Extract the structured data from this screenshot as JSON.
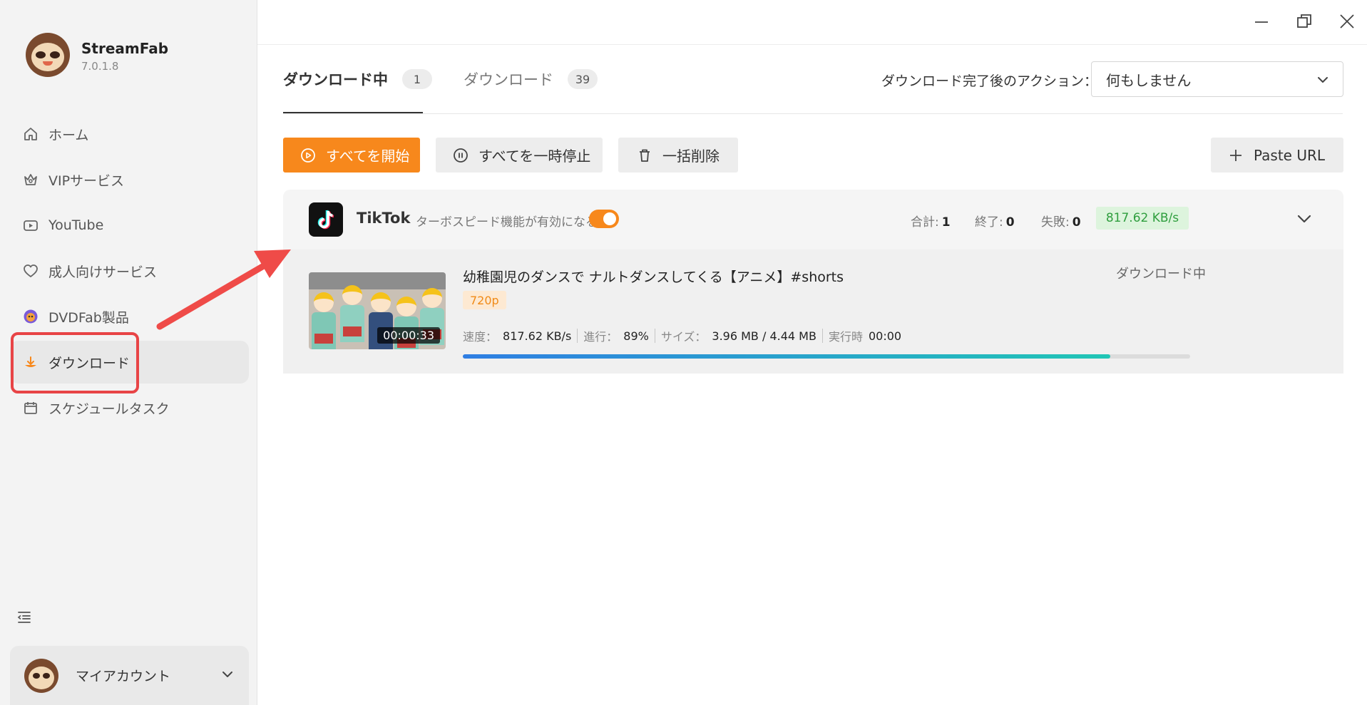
{
  "app": {
    "name": "StreamFab",
    "version": "7.0.1.8"
  },
  "sidebar": {
    "items": [
      {
        "label": "ホーム",
        "icon": "home-icon"
      },
      {
        "label": "VIPサービス",
        "icon": "vip-icon"
      },
      {
        "label": "YouTube",
        "icon": "youtube-icon"
      },
      {
        "label": "成人向けサービス",
        "icon": "heart-icon"
      },
      {
        "label": "DVDFab製品",
        "icon": "dvdfab-icon"
      },
      {
        "label": "ダウンロード",
        "icon": "download-icon",
        "active": true
      },
      {
        "label": "スケジュールタスク",
        "icon": "calendar-icon"
      }
    ],
    "account": {
      "label": "マイアカウント"
    }
  },
  "tabs": [
    {
      "label": "ダウンロード中",
      "count": "1",
      "active": true
    },
    {
      "label": "ダウンロード",
      "count": "39",
      "active": false
    }
  ],
  "after_action": {
    "label": "ダウンロード完了後のアクション：",
    "value": "何もしません"
  },
  "toolbar": {
    "start_all": "すべてを開始",
    "pause_all": "すべてを一時停止",
    "delete_all": "一括削除",
    "paste_url": "Paste URL"
  },
  "group": {
    "name": "TikTok",
    "turbo_label": "ターボスピード機能が有効になる",
    "turbo_enabled": true,
    "total_label": "合計:",
    "total_value": "1",
    "done_label": "終了:",
    "done_value": "0",
    "fail_label": "失敗:",
    "fail_value": "0",
    "speed": "817.62 KB/s"
  },
  "task": {
    "title": "幼稚園児のダンスで ナルトダンスしてくる【アニメ】#shorts",
    "quality": "720p",
    "status": "ダウンロード中",
    "duration": "00:00:33",
    "speed_label": "速度：",
    "speed_value": "817.62 KB/s",
    "progress_label": "進行：",
    "progress_value": "89%",
    "progress_fraction": 0.89,
    "size_label": "サイズ：",
    "size_value": "3.96 MB / 4.44 MB",
    "elapsed_label": "実行時",
    "elapsed_value": "00:00"
  },
  "colors": {
    "accent": "#f7881c",
    "highlight": "#e84446",
    "speed_badge_bg": "#ddf4dd",
    "speed_badge_text": "#2f9e3e",
    "progress_start": "#2f7ee3",
    "progress_end": "#21c6b5"
  }
}
